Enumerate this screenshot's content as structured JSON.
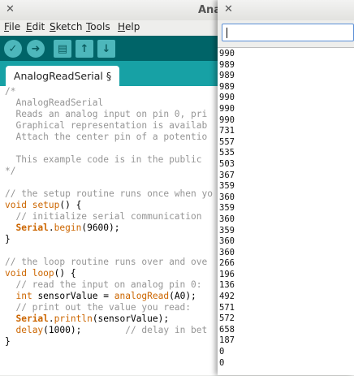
{
  "ide": {
    "title": "Anal",
    "close_glyph": "✕",
    "menu": [
      {
        "first": "F",
        "rest": "ile"
      },
      {
        "first": "E",
        "rest": "dit"
      },
      {
        "first": "S",
        "rest": "ketch"
      },
      {
        "first": "T",
        "rest": "ools"
      },
      {
        "first": "H",
        "rest": "elp"
      }
    ],
    "toolbar": {
      "verify_glyph": "✓",
      "upload_glyph": "➜",
      "new_glyph": "▤",
      "open_glyph": "↑",
      "save_glyph": "↓"
    },
    "tab_label": "AnalogReadSerial §",
    "code": {
      "l1": "/*",
      "l2": "  AnalogReadSerial",
      "l3": "  Reads an analog input on pin 0, pri",
      "l4": "  Graphical representation is availab",
      "l5": "  Attach the center pin of a potentio",
      "l6": "",
      "l7": "  This example code is in the public",
      "l8": "*/",
      "l9": "",
      "l10": "// the setup routine runs once when yo",
      "l11_kw": "void",
      "l11_fn": "setup",
      "l11_rest": "() {",
      "l12": "  // initialize serial communication",
      "l13_obj": "Serial",
      "l13_dot": ".",
      "l13_fn": "begin",
      "l13_rest": "(9600);",
      "l14": "}",
      "l15": "",
      "l16": "// the loop routine runs over and ove",
      "l17_kw": "void",
      "l17_fn": "loop",
      "l17_rest": "() {",
      "l18": "  // read the input on analog pin 0:",
      "l19_ty": "int",
      "l19_mid": " sensorValue = ",
      "l19_fn": "analogRead",
      "l19_rest": "(A0);",
      "l20": "  // print out the value you read:",
      "l21_obj": "Serial",
      "l21_dot": ".",
      "l21_fn": "println",
      "l21_rest": "(sensorValue);",
      "l22_fn": "delay",
      "l22_mid": "(1000);        ",
      "l22_cm": "// delay in bet",
      "l23": "}"
    }
  },
  "serial_monitor": {
    "close_glyph": "✕",
    "input_value": "",
    "readings": [
      "990",
      "989",
      "989",
      "989",
      "990",
      "990",
      "990",
      "731",
      "557",
      "535",
      "503",
      "367",
      "359",
      "360",
      "359",
      "360",
      "359",
      "360",
      "360",
      "266",
      "196",
      "136",
      "492",
      "571",
      "572",
      "658",
      "187",
      "0",
      "0"
    ]
  }
}
